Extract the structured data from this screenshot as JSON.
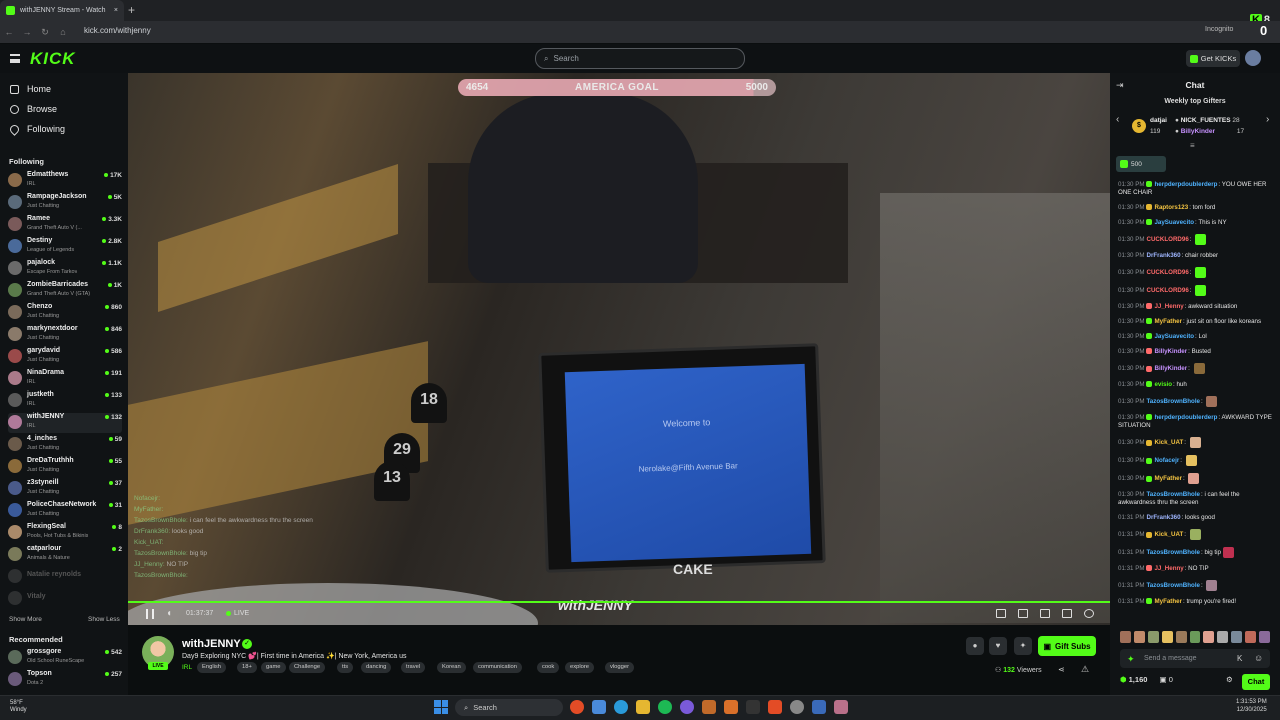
{
  "browser": {
    "tab_title": "withJENNY Stream - Watch",
    "url": "kick.com/withjenny",
    "incognito_label": "Incognito",
    "top_right_numbers": [
      "8",
      "0"
    ]
  },
  "header": {
    "logo": "KICK",
    "search_placeholder": "Search",
    "get_kicks": "Get KICKs"
  },
  "sidebar": {
    "nav": [
      {
        "label": "Home"
      },
      {
        "label": "Browse"
      },
      {
        "label": "Following"
      }
    ],
    "following_title": "Following",
    "following": [
      {
        "name": "Edmatthews",
        "category": "IRL",
        "viewers": "17K",
        "color": "#8a6a4a"
      },
      {
        "name": "RampageJackson",
        "category": "Just Chatting",
        "viewers": "5K",
        "color": "#5a6a7a"
      },
      {
        "name": "Ramee",
        "category": "Grand Theft Auto V (...",
        "viewers": "3.3K",
        "color": "#7a5a5a"
      },
      {
        "name": "Destiny",
        "category": "League of Legends",
        "viewers": "2.8K",
        "color": "#4a6a9a"
      },
      {
        "name": "pajalock",
        "category": "Escape From Tarkov",
        "viewers": "1.1K",
        "color": "#6a6a6a"
      },
      {
        "name": "ZombieBarricades",
        "category": "Grand Theft Auto V (GTA)",
        "viewers": "1K",
        "color": "#5a7a4a"
      },
      {
        "name": "Chenzo",
        "category": "Just Chatting",
        "viewers": "860",
        "color": "#7a6a5a"
      },
      {
        "name": "markynextdoor",
        "category": "Just Chatting",
        "viewers": "846",
        "color": "#8a7a6a"
      },
      {
        "name": "garydavid",
        "category": "Just Chatting",
        "viewers": "586",
        "color": "#9a4a4a"
      },
      {
        "name": "NinaDrama",
        "category": "IRL",
        "viewers": "191",
        "color": "#aa7a8a"
      },
      {
        "name": "justketh",
        "category": "IRL",
        "viewers": "133",
        "color": "#5a5a5a"
      },
      {
        "name": "withJENNY",
        "category": "IRL",
        "viewers": "132",
        "color": "#b07a9a"
      },
      {
        "name": "4_inches",
        "category": "Just Chatting",
        "viewers": "59",
        "color": "#6a5a4a"
      },
      {
        "name": "DreDaTruthhh",
        "category": "Just Chatting",
        "viewers": "55",
        "color": "#8a6a3a"
      },
      {
        "name": "z3styneill",
        "category": "Just Chatting",
        "viewers": "37",
        "color": "#4a5a8a"
      },
      {
        "name": "PoliceChaseNetwork",
        "category": "Just Chatting",
        "viewers": "31",
        "color": "#3a5a9a"
      },
      {
        "name": "FlexingSeal",
        "category": "Pools, Hot Tubs & Bikinis",
        "viewers": "8",
        "color": "#aa8a6a"
      },
      {
        "name": "catparlour",
        "category": "Animals & Nature",
        "viewers": "2",
        "color": "#7a7a5a"
      }
    ],
    "offline": [
      {
        "name": "Natalie reynolds"
      },
      {
        "name": "Vitaly"
      }
    ],
    "show_more": "Show More",
    "show_less": "Show Less",
    "recommended_title": "Recommended",
    "recommended": [
      {
        "name": "grossgore",
        "category": "Old School RuneScape",
        "viewers": "542",
        "color": "#5a6a5a"
      },
      {
        "name": "Topson",
        "category": "Dota 2",
        "viewers": "257",
        "color": "#6a5a7a"
      }
    ]
  },
  "video": {
    "goal_left": "4654",
    "goal_label": "AMERICA GOAL",
    "goal_right": "5000",
    "goal_progress": 0.93,
    "screen_line1": "Welcome to",
    "screen_line2": "Nerolake@Fifth Avenue Bar",
    "cake_label": "CAKE",
    "table_numbers": [
      "18",
      "29",
      "13"
    ],
    "watermark": "withJENNY",
    "time": "01:37:37",
    "live_label": "LIVE",
    "overlay_chat": [
      {
        "user": "Nofacejr:",
        "text": ""
      },
      {
        "user": "MyFather:",
        "text": ""
      },
      {
        "user": "TazosBrownBhole:",
        "text": "i can feel the awkwardness thru the screen"
      },
      {
        "user": "DrFrank360:",
        "text": "looks good"
      },
      {
        "user": "Kick_UAT:",
        "text": ""
      },
      {
        "user": "TazosBrownBhole:",
        "text": "big tip"
      },
      {
        "user": "JJ_Henny:",
        "text": "NO TIP"
      },
      {
        "user": "TazosBrownBhole:",
        "text": ""
      }
    ]
  },
  "stream": {
    "name": "withJENNY",
    "verified_mark": "✓",
    "title": "Day9 Exploring NYC 💕| First time in America ✨| New York, America us",
    "category": "IRL",
    "live_badge": "LIVE",
    "tags": [
      "English",
      "18+",
      "game",
      "Challenge",
      "tts",
      "dancing",
      "travel",
      "Korean",
      "communication",
      "cook",
      "explore",
      "vlogger"
    ],
    "gift_subs": "Gift Subs",
    "viewers": "132",
    "viewers_label": "Viewers"
  },
  "chat": {
    "title": "Chat",
    "weekly_title": "Weekly top Gifters",
    "gifters": [
      {
        "name": "datjai",
        "count": "119"
      },
      {
        "name": "NICK_FUENTES",
        "count": "28"
      },
      {
        "name": "BillyKinder",
        "count": "17"
      }
    ],
    "pinned_value": "500",
    "messages": [
      {
        "time": "01:30 PM",
        "user": "herpderpdoublerderp",
        "ucolor": "#4fb3ff",
        "badge": "#53fc18",
        "text": "YOU OWE HER ONE CHAIR"
      },
      {
        "time": "01:30 PM",
        "user": "Raptors123",
        "ucolor": "#f5c542",
        "badge": "#e5b731",
        "text": "tom ford"
      },
      {
        "time": "01:30 PM",
        "user": "JaySuavecito",
        "ucolor": "#4fb3ff",
        "badge": "#53fc18",
        "text": "This is NY"
      },
      {
        "time": "01:30 PM",
        "user": "CUCKLORD96",
        "ucolor": "#ff6a6a",
        "badge": "",
        "text": "",
        "emote": "#53fc18"
      },
      {
        "time": "01:30 PM",
        "user": "DrFrank360",
        "ucolor": "#9fb6ff",
        "badge": "",
        "text": "chair robber"
      },
      {
        "time": "01:30 PM",
        "user": "CUCKLORD96",
        "ucolor": "#ff6a6a",
        "badge": "",
        "text": "",
        "emote": "#53fc18"
      },
      {
        "time": "01:30 PM",
        "user": "CUCKLORD96",
        "ucolor": "#ff6a6a",
        "badge": "",
        "text": "",
        "emote": "#53fc18"
      },
      {
        "time": "01:30 PM",
        "user": "JJ_Henny",
        "ucolor": "#ff6a6a",
        "badge": "#ff6a6a",
        "text": "awkward situation"
      },
      {
        "time": "01:30 PM",
        "user": "MyFather",
        "ucolor": "#f5c542",
        "badge": "#53fc18",
        "text": "just sit on floor like koreans"
      },
      {
        "time": "01:30 PM",
        "user": "JaySuavecito",
        "ucolor": "#4fb3ff",
        "badge": "#53fc18",
        "text": "Lol"
      },
      {
        "time": "01:30 PM",
        "user": "BillyKinder",
        "ucolor": "#c792ff",
        "badge": "#ff6a6a",
        "text": "Busted"
      },
      {
        "time": "01:30 PM",
        "user": "BillyKinder",
        "ucolor": "#c792ff",
        "badge": "#ff6a6a",
        "text": "",
        "emote": "#8a6a3a"
      },
      {
        "time": "01:30 PM",
        "user": "evisio",
        "ucolor": "#53fc18",
        "badge": "#53fc18",
        "text": "huh"
      },
      {
        "time": "01:30 PM",
        "user": "TazosBrownBhole",
        "ucolor": "#4fb3ff",
        "badge": "",
        "text": "",
        "emote": "#a0705a"
      },
      {
        "time": "01:30 PM",
        "user": "herpderpdoublerderp",
        "ucolor": "#4fb3ff",
        "badge": "#53fc18",
        "text": "AWKWARD TYPE SITUATION"
      },
      {
        "time": "01:30 PM",
        "user": "Kick_UAT",
        "ucolor": "#f5c542",
        "badge": "#e5b731",
        "text": "",
        "emote": "#d8b090"
      },
      {
        "time": "01:30 PM",
        "user": "Nofacejr",
        "ucolor": "#4fb3ff",
        "badge": "#53fc18",
        "text": "",
        "emote": "#e5c060"
      },
      {
        "time": "01:30 PM",
        "user": "MyFather",
        "ucolor": "#f5c542",
        "badge": "#53fc18",
        "text": "",
        "emote": "#e0a090"
      },
      {
        "time": "01:30 PM",
        "user": "TazosBrownBhole",
        "ucolor": "#4fb3ff",
        "badge": "",
        "text": "i can feel the awkwardness thru the screen"
      },
      {
        "time": "01:31 PM",
        "user": "DrFrank360",
        "ucolor": "#9fb6ff",
        "badge": "",
        "text": "looks good"
      },
      {
        "time": "01:31 PM",
        "user": "Kick_UAT",
        "ucolor": "#f5c542",
        "badge": "#e5b731",
        "text": "",
        "emote": "#9ab060"
      },
      {
        "time": "01:31 PM",
        "user": "TazosBrownBhole",
        "ucolor": "#4fb3ff",
        "badge": "",
        "text": "big tip",
        "emote": "#c03050"
      },
      {
        "time": "01:31 PM",
        "user": "JJ_Henny",
        "ucolor": "#ff6a6a",
        "badge": "#ff6a6a",
        "text": "NO TIP"
      },
      {
        "time": "01:31 PM",
        "user": "TazosBrownBhole",
        "ucolor": "#4fb3ff",
        "badge": "",
        "text": "",
        "emote": "#a08090"
      },
      {
        "time": "01:31 PM",
        "user": "MyFather",
        "ucolor": "#f5c542",
        "badge": "#53fc18",
        "text": "trump you're fired!"
      }
    ],
    "input_placeholder": "Send a message",
    "kicks_count": "1,160",
    "zero_count": "0",
    "chat_button": "Chat"
  },
  "taskbar": {
    "weather_temp": "58°F",
    "weather_desc": "Windy",
    "search_label": "Search",
    "time": "1:31:53 PM",
    "date": "12/30/2025"
  },
  "colors": {
    "accent": "#53fc18",
    "background": "#0b0e0f"
  }
}
